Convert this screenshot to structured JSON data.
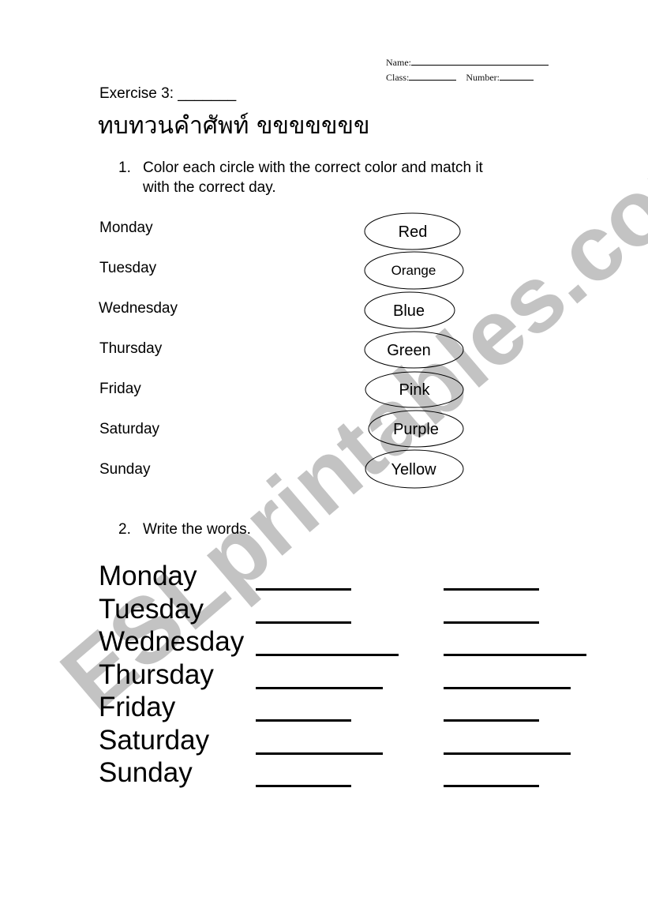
{
  "header": {
    "name_label": "Name:",
    "class_label": "Class:",
    "number_label": "Number:"
  },
  "exercise_title": "Exercise 3:",
  "exercise_blank": "_______",
  "thai_title": "ทบทวนคำศัพท์ ขขขขขขข",
  "section1": {
    "number": "1.",
    "instruction_line1": "Color each circle with the correct color and match it",
    "instruction_line2": "with the correct day.",
    "days": [
      "Monday",
      "Tuesday",
      "Wednesday",
      "Thursday",
      "Friday",
      "Saturday",
      "Sunday"
    ],
    "colors": [
      "Red",
      "Orange",
      "Blue",
      "Green",
      "Pink",
      "Purple",
      "Yellow"
    ]
  },
  "section2": {
    "number": "2.",
    "instruction": "Write the words.",
    "words": [
      "Monday",
      "Tuesday",
      "Wednesday",
      "Thursday",
      "Friday",
      "Saturday",
      "Sunday"
    ]
  },
  "watermark": {
    "text": "ESLprintables.com",
    "color": "#c3c3c3"
  }
}
